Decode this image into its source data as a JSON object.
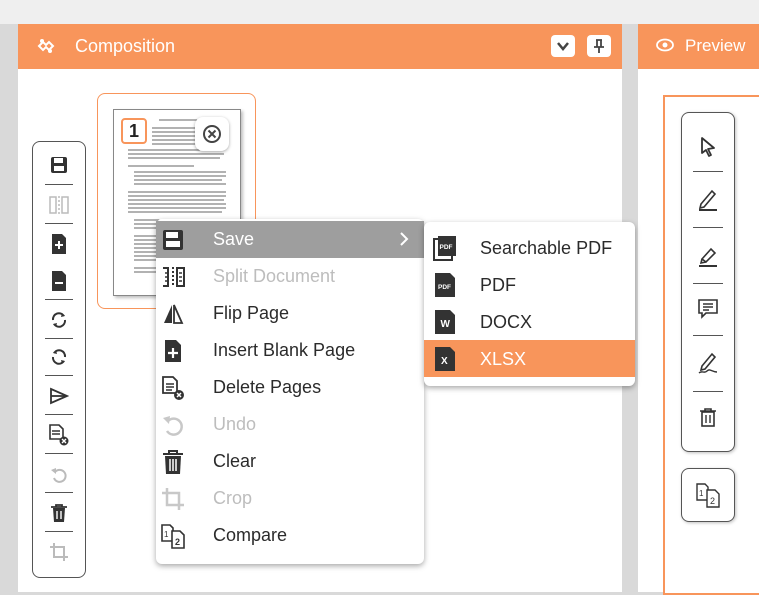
{
  "composition": {
    "title": "Composition",
    "icon": "puzzle-icon",
    "header_buttons": [
      "collapse-chevron-icon",
      "pin-icon"
    ]
  },
  "preview": {
    "title": "Preview",
    "icon": "eye-icon"
  },
  "thumbnail": {
    "page_number": "1"
  },
  "context_menu": {
    "items": [
      {
        "label": "Save",
        "icon": "save-icon",
        "enabled": true,
        "highlighted": true,
        "has_submenu": true
      },
      {
        "label": "Split Document",
        "icon": "split-icon",
        "enabled": false
      },
      {
        "label": "Flip Page",
        "icon": "flip-icon",
        "enabled": true
      },
      {
        "label": "Insert Blank Page",
        "icon": "insert-page-icon",
        "enabled": true
      },
      {
        "label": "Delete Pages",
        "icon": "delete-pages-icon",
        "enabled": true
      },
      {
        "label": "Undo",
        "icon": "undo-icon",
        "enabled": false
      },
      {
        "label": "Clear",
        "icon": "trash-icon",
        "enabled": true
      },
      {
        "label": "Crop",
        "icon": "crop-icon",
        "enabled": false
      },
      {
        "label": "Compare",
        "icon": "compare-icon",
        "enabled": true
      }
    ]
  },
  "save_submenu": {
    "items": [
      {
        "label": "Searchable PDF",
        "icon": "searchable-pdf-icon",
        "badge": "PDF"
      },
      {
        "label": "PDF",
        "icon": "pdf-file-icon",
        "badge": "PDF"
      },
      {
        "label": "DOCX",
        "icon": "docx-file-icon",
        "badge": "W"
      },
      {
        "label": "XLSX",
        "icon": "xlsx-file-icon",
        "badge": "X",
        "highlighted": true
      }
    ]
  },
  "left_toolbar": [
    "save-icon",
    "split-icon",
    "insert-page-icon",
    "remove-page-icon",
    "rotate-cw-icon",
    "rotate-ccw-icon",
    "flip-icon",
    "delete-pages-icon",
    "undo-icon",
    "trash-icon",
    "crop-icon"
  ],
  "preview_toolbar": [
    "pointer-icon",
    "pen-icon",
    "highlighter-icon",
    "comment-icon",
    "signature-icon",
    "trash-icon"
  ],
  "colors": {
    "accent": "#f8955b",
    "menu_highlight": "#9e9e9e",
    "disabled_text": "#bdbdbd"
  }
}
